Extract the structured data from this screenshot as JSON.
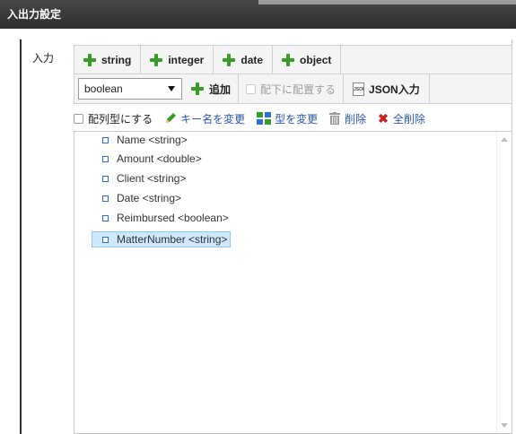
{
  "panel": {
    "title": "入出力設定"
  },
  "input": {
    "label": "入力"
  },
  "type_buttons": [
    {
      "label": "string"
    },
    {
      "label": "integer"
    },
    {
      "label": "date"
    },
    {
      "label": "object"
    }
  ],
  "controls": {
    "type_select": {
      "value": "boolean"
    },
    "add_label": "追加",
    "place_under_label": "配下に配置する",
    "json_input_label": "JSON入力",
    "json_icon_text": "JSON"
  },
  "actions": {
    "array_label": "配列型にする",
    "rename_key_label": "キー名を変更",
    "change_type_label": "型を変更",
    "delete_label": "削除",
    "delete_all_label": "全削除"
  },
  "tree": {
    "items": [
      {
        "label": "Name <string>"
      },
      {
        "label": "Amount <double>"
      },
      {
        "label": "Client <string>"
      },
      {
        "label": "Date <string>"
      },
      {
        "label": "Reimbursed <boolean>"
      },
      {
        "label": "MatterNumber <string>",
        "selected": true
      }
    ]
  },
  "colors": {
    "title_bar": "#3a3a3a",
    "plus_green": "#3a9b2b",
    "link_blue": "#2a55b5",
    "selection_bg": "#cde8ff",
    "delete_red": "#cc2020"
  }
}
